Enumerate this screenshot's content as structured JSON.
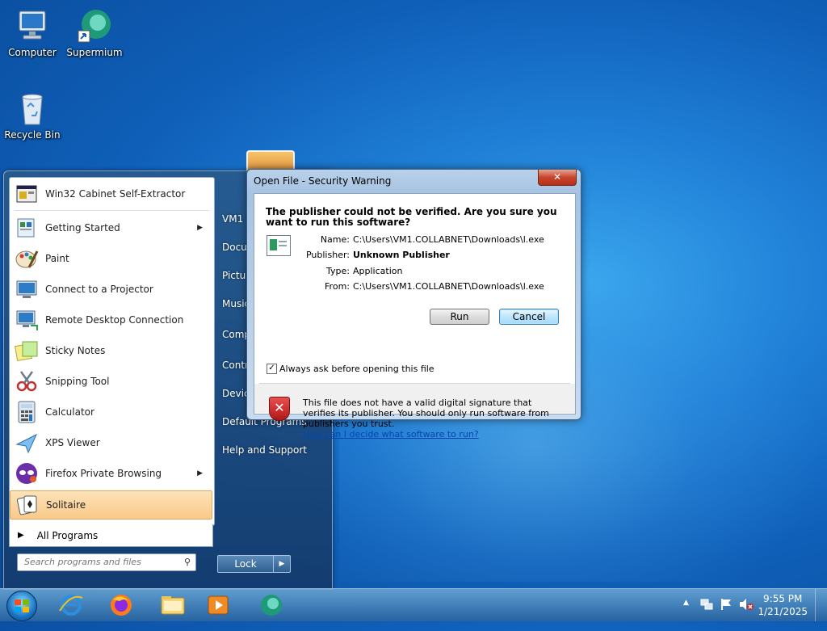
{
  "desktop": {
    "icons": [
      {
        "label": "Computer"
      },
      {
        "label": "Supermium"
      },
      {
        "label": "Recycle Bin"
      }
    ]
  },
  "start_menu": {
    "programs": [
      {
        "label": "Win32 Cabinet Self-Extractor",
        "has_submenu": false
      },
      {
        "label": "Getting Started",
        "has_submenu": true
      },
      {
        "label": "Paint",
        "has_submenu": false
      },
      {
        "label": "Connect to a Projector",
        "has_submenu": false
      },
      {
        "label": "Remote Desktop Connection",
        "has_submenu": false
      },
      {
        "label": "Sticky Notes",
        "has_submenu": false
      },
      {
        "label": "Snipping Tool",
        "has_submenu": false
      },
      {
        "label": "Calculator",
        "has_submenu": false
      },
      {
        "label": "XPS Viewer",
        "has_submenu": false
      },
      {
        "label": "Firefox Private Browsing",
        "has_submenu": true
      },
      {
        "label": "Solitaire",
        "has_submenu": false,
        "highlighted": true
      }
    ],
    "all_programs": "All Programs",
    "search_placeholder": "Search programs and files",
    "right_items": [
      {
        "label": "VM1"
      },
      {
        "label": "Docu"
      },
      {
        "label": "Pictu"
      },
      {
        "label": "Music"
      },
      {
        "label": "Comp"
      },
      {
        "label": "Contr"
      },
      {
        "label": "Devic"
      },
      {
        "label": "Default Programs"
      },
      {
        "label": "Help and Support"
      }
    ],
    "lock_label": "Lock"
  },
  "dialog": {
    "title": "Open File - Security Warning",
    "close_label": "✕",
    "question": "The publisher could not be verified.  Are you sure you want to run this software?",
    "fields": [
      {
        "key": "Name:",
        "value": "C:\\Users\\VM1.COLLABNET\\Downloads\\l.exe",
        "bold": false
      },
      {
        "key": "Publisher:",
        "value": "Unknown Publisher",
        "bold": true
      },
      {
        "key": "Type:",
        "value": "Application",
        "bold": false
      },
      {
        "key": "From:",
        "value": "C:\\Users\\VM1.COLLABNET\\Downloads\\l.exe",
        "bold": false
      }
    ],
    "run_label": "Run",
    "cancel_label": "Cancel",
    "checkbox_label": "Always ask before opening this file",
    "checkbox_checked": true,
    "footer_text": "This file does not have a valid digital signature that verifies its publisher.  You should only run software from publishers you trust.",
    "footer_link": "How can I decide what software to run?"
  },
  "taskbar": {
    "pinned": [
      {
        "icon": "internet-explorer-icon"
      },
      {
        "icon": "firefox-icon"
      },
      {
        "icon": "file-explorer-icon"
      },
      {
        "icon": "media-player-icon"
      },
      {
        "icon": "supermium-icon"
      }
    ],
    "time": "9:55 PM",
    "date": "1/21/2025"
  },
  "colors": {
    "accent": "#1f7fd6",
    "highlight": "#f9c98a",
    "close_button": "#c7452c",
    "link": "#0645ad"
  }
}
